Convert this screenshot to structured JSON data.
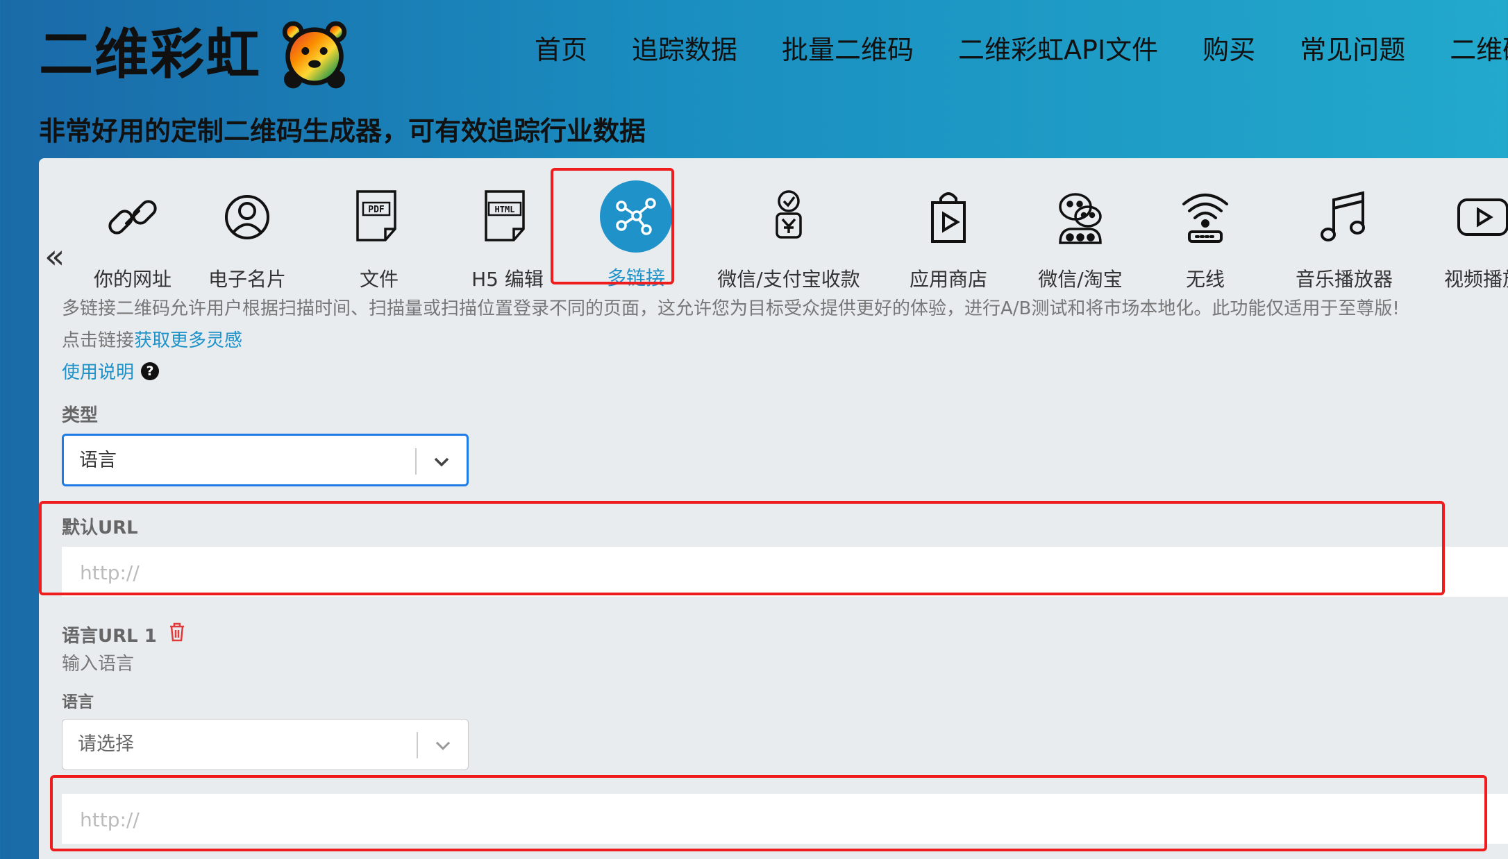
{
  "header": {
    "logo_text": "二维彩虹",
    "nav": [
      "首页",
      "追踪数据",
      "批量二维码",
      "二维彩虹API文件",
      "购买",
      "常见问题",
      "二维码学"
    ],
    "tagline": "非常好用的定制二维码生成器，可有效追踪行业数据"
  },
  "types": [
    {
      "label": "你的网址",
      "icon": "link-icon"
    },
    {
      "label": "电子名片",
      "icon": "user-icon"
    },
    {
      "label": "文件",
      "icon": "pdf-file-icon",
      "badge": "PDF"
    },
    {
      "label": "H5 编辑",
      "icon": "html-file-icon",
      "badge": "HTML"
    },
    {
      "label": "多链接",
      "icon": "multi-link-icon",
      "active": true
    },
    {
      "label": "微信/支付宝收款",
      "icon": "payment-icon"
    },
    {
      "label": "应用商店",
      "icon": "app-store-icon"
    },
    {
      "label": "微信/淘宝",
      "icon": "wechat-icon"
    },
    {
      "label": "无线",
      "icon": "wifi-icon"
    },
    {
      "label": "音乐播放器",
      "icon": "music-icon"
    },
    {
      "label": "视频播放",
      "icon": "video-icon"
    }
  ],
  "content": {
    "description": "多链接二维码允许用户根据扫描时间、扫描量或扫描位置登录不同的页面，这允许您为目标受众提供更好的体验，进行A/B测试和将市场本地化。此功能仅适用于至尊版!",
    "inspire_prefix": "点击链接",
    "inspire_link": "获取更多灵感",
    "help_label": "使用说明",
    "help_icon": "?"
  },
  "form": {
    "type_label": "类型",
    "type_value": "语言",
    "default_url_label": "默认URL",
    "default_url_placeholder": "http://",
    "lang_url_label": "语言URL 1",
    "lang_url_hint": "输入语言",
    "language_label": "语言",
    "language_placeholder": "请选择",
    "lang_url_placeholder": "http://"
  },
  "colors": {
    "accent": "#1f93c9",
    "highlight": "#ee1c1c",
    "focus": "#1d7be8"
  }
}
